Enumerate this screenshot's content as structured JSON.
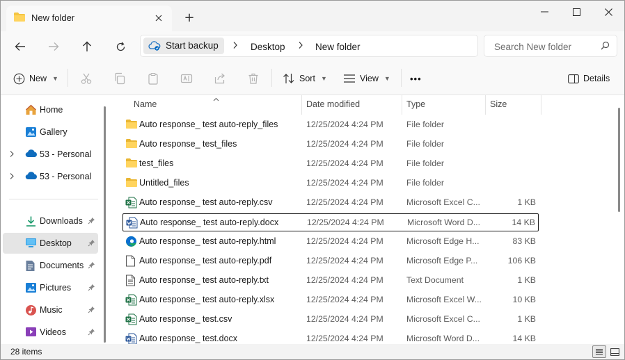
{
  "window": {
    "tab_title": "New folder",
    "new_tab_symbol": "+",
    "controls": [
      "minimize-icon",
      "maximize-icon",
      "close-icon"
    ]
  },
  "nav": {
    "backup_label": "Start backup",
    "breadcrumbs": [
      "Desktop",
      "New folder"
    ],
    "search_placeholder": "Search New folder"
  },
  "toolbar": {
    "new_label": "New",
    "sort_label": "Sort",
    "view_label": "View",
    "more_label": "•••",
    "details_label": "Details"
  },
  "sidebar": {
    "items": [
      {
        "label": "Home",
        "icon": "home-icon"
      },
      {
        "label": "Gallery",
        "icon": "gallery-icon"
      },
      {
        "label": "53 - Personal",
        "icon": "onedrive-icon"
      },
      {
        "label": "53 - Personal",
        "icon": "onedrive-icon"
      },
      {
        "label": "Downloads",
        "icon": "downloads-icon"
      },
      {
        "label": "Desktop",
        "icon": "desktop-icon"
      },
      {
        "label": "Documents",
        "icon": "documents-icon"
      },
      {
        "label": "Pictures",
        "icon": "pictures-icon"
      },
      {
        "label": "Music",
        "icon": "music-icon"
      },
      {
        "label": "Videos",
        "icon": "videos-icon"
      }
    ]
  },
  "columns": {
    "name": "Name",
    "date": "Date modified",
    "type": "Type",
    "size": "Size"
  },
  "files": [
    {
      "name": "Auto response_ test auto-reply_files",
      "date": "12/25/2024 4:24 PM",
      "type": "File folder",
      "size": "",
      "icon": "folder-icon"
    },
    {
      "name": "Auto response_ test_files",
      "date": "12/25/2024 4:24 PM",
      "type": "File folder",
      "size": "",
      "icon": "folder-icon"
    },
    {
      "name": "test_files",
      "date": "12/25/2024 4:24 PM",
      "type": "File folder",
      "size": "",
      "icon": "folder-icon"
    },
    {
      "name": "Untitled_files",
      "date": "12/25/2024 4:24 PM",
      "type": "File folder",
      "size": "",
      "icon": "folder-icon"
    },
    {
      "name": "Auto response_ test auto-reply.csv",
      "date": "12/25/2024 4:24 PM",
      "type": "Microsoft Excel C...",
      "size": "1 KB",
      "icon": "excel-icon"
    },
    {
      "name": "Auto response_ test auto-reply.docx",
      "date": "12/25/2024 4:24 PM",
      "type": "Microsoft Word D...",
      "size": "14 KB",
      "icon": "word-icon"
    },
    {
      "name": "Auto response_ test auto-reply.html",
      "date": "12/25/2024 4:24 PM",
      "type": "Microsoft Edge H...",
      "size": "83 KB",
      "icon": "edge-icon"
    },
    {
      "name": "Auto response_ test auto-reply.pdf",
      "date": "12/25/2024 4:24 PM",
      "type": "Microsoft Edge P...",
      "size": "106 KB",
      "icon": "pdf-file-icon"
    },
    {
      "name": "Auto response_ test auto-reply.txt",
      "date": "12/25/2024 4:24 PM",
      "type": "Text Document",
      "size": "1 KB",
      "icon": "text-file-icon"
    },
    {
      "name": "Auto response_ test auto-reply.xlsx",
      "date": "12/25/2024 4:24 PM",
      "type": "Microsoft Excel W...",
      "size": "10 KB",
      "icon": "excel-icon"
    },
    {
      "name": "Auto response_ test.csv",
      "date": "12/25/2024 4:24 PM",
      "type": "Microsoft Excel C...",
      "size": "1 KB",
      "icon": "excel-icon"
    },
    {
      "name": "Auto response_ test.docx",
      "date": "12/25/2024 4:24 PM",
      "type": "Microsoft Word D...",
      "size": "14 KB",
      "icon": "word-icon"
    }
  ],
  "status": {
    "item_count": "28 items"
  },
  "colors": {
    "folder": "#f4c542",
    "excel": "#1e7145",
    "word": "#2b579a",
    "accent": "#0067c0"
  }
}
